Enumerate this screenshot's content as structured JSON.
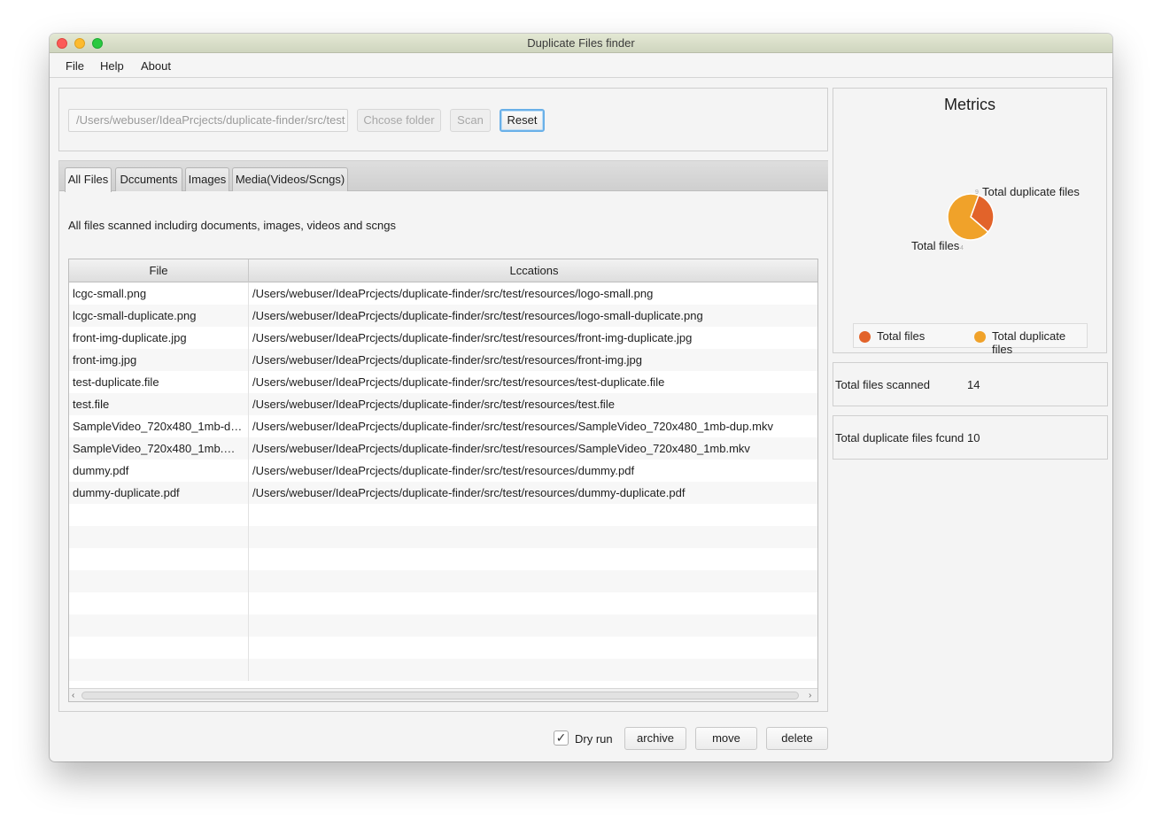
{
  "window": {
    "title": "Duplicate Files finder"
  },
  "menu": {
    "items": [
      "File",
      "Help",
      "About"
    ]
  },
  "toolbar": {
    "path_value": "/Users/webuser/IdeaPrcjects/duplicate-finder/src/test",
    "choose_folder_label": "Chcose folder",
    "scan_label": "Scan",
    "reset_label": "Reset"
  },
  "tabs": [
    {
      "label": "All Files",
      "active": true
    },
    {
      "label": "Dccuments",
      "active": false
    },
    {
      "label": "Images",
      "active": false
    },
    {
      "label": "Media(Videos/Scngs)",
      "active": false
    }
  ],
  "description": "All files scanned includirg documents, images, videos and scngs",
  "table": {
    "columns": [
      "File",
      "Lccations"
    ],
    "rows": [
      {
        "file": "lcgc-small.png",
        "location": "/Users/webuser/IdeaPrcjects/duplicate-finder/src/test/resources/logo-small.png"
      },
      {
        "file": "lcgc-small-duplicate.png",
        "location": "/Users/webuser/IdeaPrcjects/duplicate-finder/src/test/resources/logo-small-duplicate.png"
      },
      {
        "file": "front-img-duplicate.jpg",
        "location": "/Users/webuser/IdeaPrcjects/duplicate-finder/src/test/resources/front-img-duplicate.jpg"
      },
      {
        "file": "front-img.jpg",
        "location": "/Users/webuser/IdeaPrcjects/duplicate-finder/src/test/resources/front-img.jpg"
      },
      {
        "file": "test-duplicate.file",
        "location": "/Users/webuser/IdeaPrcjects/duplicate-finder/src/test/resources/test-duplicate.file"
      },
      {
        "file": "test.file",
        "location": "/Users/webuser/IdeaPrcjects/duplicate-finder/src/test/resources/test.file"
      },
      {
        "file": "SampleVideo_720x480_1mb-du...",
        "location": "/Users/webuser/IdeaPrcjects/duplicate-finder/src/test/resources/SampleVideo_720x480_1mb-dup.mkv"
      },
      {
        "file": "SampleVideo_720x480_1mb.mkv",
        "location": "/Users/webuser/IdeaPrcjects/duplicate-finder/src/test/resources/SampleVideo_720x480_1mb.mkv"
      },
      {
        "file": "dummy.pdf",
        "location": "/Users/webuser/IdeaPrcjects/duplicate-finder/src/test/resources/dummy.pdf"
      },
      {
        "file": "dummy-duplicate.pdf",
        "location": "/Users/webuser/IdeaPrcjects/duplicate-finder/src/test/resources/dummy-duplicate.pdf"
      },
      {
        "file": "",
        "location": ""
      },
      {
        "file": "",
        "location": ""
      },
      {
        "file": "",
        "location": ""
      },
      {
        "file": "",
        "location": ""
      },
      {
        "file": "",
        "location": ""
      },
      {
        "file": "",
        "location": ""
      },
      {
        "file": "",
        "location": ""
      },
      {
        "file": "",
        "location": ""
      }
    ]
  },
  "actions": {
    "dry_run_label": "Dry run",
    "dry_run_checked": true,
    "archive_label": "archive",
    "move_label": "move",
    "delete_label": "delete"
  },
  "metrics": {
    "title": "Metrics",
    "stats": [
      {
        "label": "Total files scanned",
        "value": "14"
      },
      {
        "label": "Total duplicate files fcund",
        "value": "10"
      }
    ]
  },
  "chart_data": {
    "type": "pie",
    "title": "",
    "categories": [
      "Total files",
      "Total duplicate files"
    ],
    "values": [
      4,
      9
    ],
    "slice_value_labels": [
      "4",
      "9"
    ],
    "colors": [
      "#e2632a",
      "#f0a22a"
    ],
    "legend": [
      "Total files",
      "Total duplicate files"
    ],
    "legend_position": "bottom"
  },
  "colors": {
    "accent_focus": "#6ab0e8",
    "pie_total_files": "#e2632a",
    "pie_duplicate_files": "#f0a22a"
  },
  "icons": {
    "close": "close-window-icon",
    "minimize": "minimize-window-icon",
    "maximize": "maximize-window-icon",
    "check": "checkmark-icon",
    "scroll_left": "chevron-left-icon",
    "scroll_right": "chevron-right-icon"
  }
}
